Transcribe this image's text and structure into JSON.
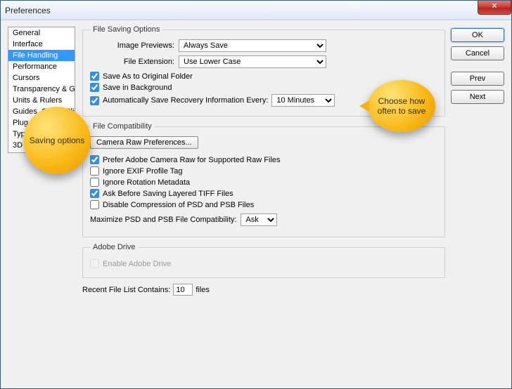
{
  "window": {
    "title": "Preferences"
  },
  "sidebar": {
    "items": [
      {
        "label": "General"
      },
      {
        "label": "Interface"
      },
      {
        "label": "File Handling",
        "selected": true
      },
      {
        "label": "Performance"
      },
      {
        "label": "Cursors"
      },
      {
        "label": "Transparency & Gamut"
      },
      {
        "label": "Units & Rulers"
      },
      {
        "label": "Guides, Grid & Slices"
      },
      {
        "label": "Plug-Ins"
      },
      {
        "label": "Type"
      },
      {
        "label": "3D"
      }
    ]
  },
  "buttons": {
    "ok": "OK",
    "cancel": "Cancel",
    "prev": "Prev",
    "next": "Next"
  },
  "file_saving": {
    "legend": "File Saving Options",
    "image_previews_label": "Image Previews:",
    "image_previews_value": "Always Save",
    "file_extension_label": "File Extension:",
    "file_extension_value": "Use Lower Case",
    "save_as_original": "Save As to Original Folder",
    "save_in_background": "Save in Background",
    "auto_save_label": "Automatically Save Recovery Information Every:",
    "auto_save_interval": "10 Minutes"
  },
  "file_compat": {
    "legend": "File Compatibility",
    "camera_raw_btn": "Camera Raw Preferences...",
    "prefer_acr": "Prefer Adobe Camera Raw for Supported Raw Files",
    "ignore_exif": "Ignore EXIF Profile Tag",
    "ignore_rotation": "Ignore Rotation Metadata",
    "ask_tiff": "Ask Before Saving Layered TIFF Files",
    "disable_compress": "Disable Compression of PSD and PSB Files",
    "maximize_label": "Maximize PSD and PSB File Compatibility:",
    "maximize_value": "Ask"
  },
  "adobe_drive": {
    "legend": "Adobe Drive",
    "enable": "Enable Adobe Drive"
  },
  "recent": {
    "label_pre": "Recent File List Contains:",
    "value": "10",
    "label_post": "files"
  },
  "callouts": {
    "left": "Saving options",
    "right": "Choose how often to save"
  }
}
